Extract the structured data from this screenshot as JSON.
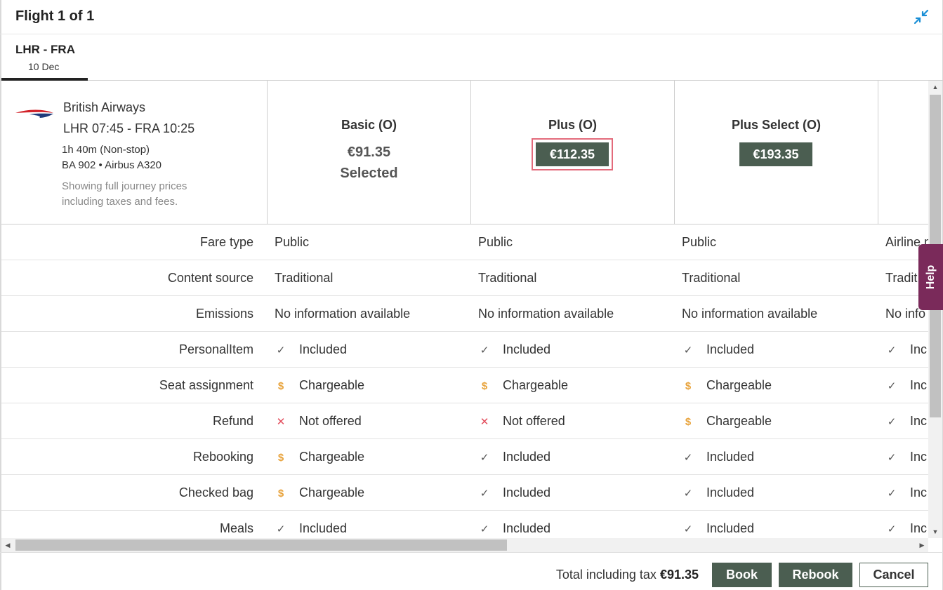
{
  "header": {
    "title": "Flight 1 of 1",
    "collapse_icon": "collapse-arrows-icon"
  },
  "tab": {
    "route": "LHR - FRA",
    "date": "10 Dec"
  },
  "flight": {
    "airline": "British Airways",
    "times": "LHR 07:45 - FRA 10:25",
    "duration": "1h 40m (Non-stop)",
    "flight_number": "BA 902 • Airbus A320",
    "note": "Showing full journey prices including taxes and fees."
  },
  "fares": [
    {
      "name": "Basic (O)",
      "price": "€91.35",
      "status": "Selected"
    },
    {
      "name": "Plus (O)",
      "price": "€112.35"
    },
    {
      "name": "Plus Select (O)",
      "price": "€193.35"
    }
  ],
  "rows": [
    {
      "label": "Fare type",
      "cells": [
        {
          "text": "Public"
        },
        {
          "text": "Public"
        },
        {
          "text": "Public"
        },
        {
          "text": "Airline m"
        }
      ]
    },
    {
      "label": "Content source",
      "cells": [
        {
          "text": "Traditional"
        },
        {
          "text": "Traditional"
        },
        {
          "text": "Traditional"
        },
        {
          "text": "Tradit"
        }
      ]
    },
    {
      "label": "Emissions",
      "cells": [
        {
          "text": "No information available"
        },
        {
          "text": "No information available"
        },
        {
          "text": "No information available"
        },
        {
          "text": "No info"
        }
      ]
    },
    {
      "label": "PersonalItem",
      "cells": [
        {
          "icon": "check",
          "text": "Included"
        },
        {
          "icon": "check",
          "text": "Included"
        },
        {
          "icon": "check",
          "text": "Included"
        },
        {
          "icon": "check",
          "text": "Inc"
        }
      ]
    },
    {
      "label": "Seat assignment",
      "cells": [
        {
          "icon": "charge",
          "text": "Chargeable"
        },
        {
          "icon": "charge",
          "text": "Chargeable"
        },
        {
          "icon": "charge",
          "text": "Chargeable"
        },
        {
          "icon": "check",
          "text": "Inc"
        }
      ]
    },
    {
      "label": "Refund",
      "cells": [
        {
          "icon": "x",
          "text": "Not offered"
        },
        {
          "icon": "x",
          "text": "Not offered"
        },
        {
          "icon": "charge",
          "text": "Chargeable"
        },
        {
          "icon": "check",
          "text": "Inc"
        }
      ]
    },
    {
      "label": "Rebooking",
      "cells": [
        {
          "icon": "charge",
          "text": "Chargeable"
        },
        {
          "icon": "check",
          "text": "Included"
        },
        {
          "icon": "check",
          "text": "Included"
        },
        {
          "icon": "check",
          "text": "Inc"
        }
      ]
    },
    {
      "label": "Checked bag",
      "cells": [
        {
          "icon": "charge",
          "text": "Chargeable"
        },
        {
          "icon": "check",
          "text": "Included"
        },
        {
          "icon": "check",
          "text": "Included"
        },
        {
          "icon": "check",
          "text": "Inc"
        }
      ]
    },
    {
      "label": "Meals",
      "cells": [
        {
          "icon": "check",
          "text": "Included"
        },
        {
          "icon": "check",
          "text": "Included"
        },
        {
          "icon": "check",
          "text": "Included"
        },
        {
          "icon": "check",
          "text": "Inc"
        }
      ]
    }
  ],
  "help": {
    "label": "Help"
  },
  "footer": {
    "total_label": "Total including tax",
    "total_value": "€91.35",
    "book_label": "Book",
    "rebook_label": "Rebook",
    "cancel_label": "Cancel"
  },
  "colors": {
    "primary": "#4b5e51",
    "help": "#7a2a5a",
    "chargeable": "#e8a33c",
    "not_offered": "#e24d5c",
    "highlight": "#e36a7b"
  }
}
